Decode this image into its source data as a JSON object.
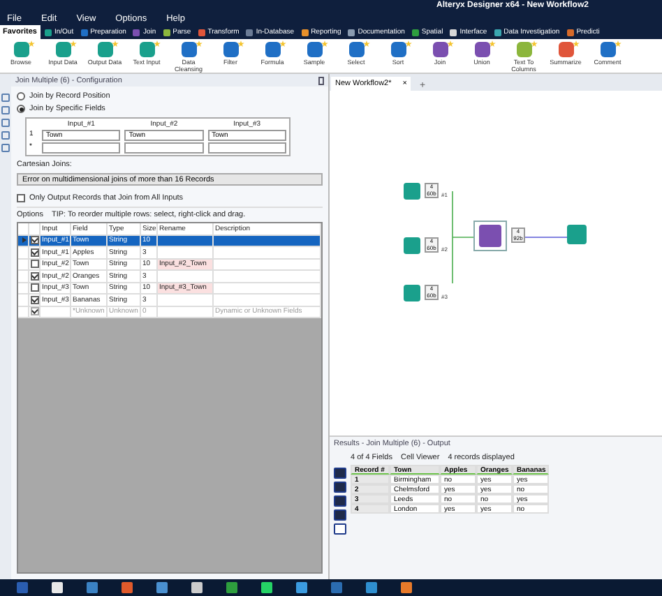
{
  "window": {
    "title": "Alteryx Designer x64 - New Workflow2"
  },
  "menu": [
    "File",
    "Edit",
    "View",
    "Options",
    "Help"
  ],
  "favorites": {
    "label": "Favorites",
    "selected": true
  },
  "categories": [
    {
      "label": "In/Out",
      "color": "#1aa08c"
    },
    {
      "label": "Preparation",
      "color": "#1f6fc5"
    },
    {
      "label": "Join",
      "color": "#7b4fb0"
    },
    {
      "label": "Parse",
      "color": "#8cb63c"
    },
    {
      "label": "Transform",
      "color": "#e0553a"
    },
    {
      "label": "In-Database",
      "color": "#6b7b95"
    },
    {
      "label": "Reporting",
      "color": "#e8902a"
    },
    {
      "label": "Documentation",
      "color": "#8a9bb0"
    },
    {
      "label": "Spatial",
      "color": "#2e9e3e"
    },
    {
      "label": "Interface",
      "color": "#d8d8d8"
    },
    {
      "label": "Data Investigation",
      "color": "#3aa6b0"
    },
    {
      "label": "Predicti",
      "color": "#d66a2a"
    }
  ],
  "tools": [
    {
      "label": "Browse",
      "color": "#1aa08c"
    },
    {
      "label": "Input Data",
      "color": "#1aa08c"
    },
    {
      "label": "Output Data",
      "color": "#1aa08c"
    },
    {
      "label": "Text Input",
      "color": "#1aa08c"
    },
    {
      "label": "Data Cleansing",
      "color": "#1f6fc5"
    },
    {
      "label": "Filter",
      "color": "#1f6fc5"
    },
    {
      "label": "Formula",
      "color": "#1f6fc5"
    },
    {
      "label": "Sample",
      "color": "#1f6fc5"
    },
    {
      "label": "Select",
      "color": "#1f6fc5"
    },
    {
      "label": "Sort",
      "color": "#1f6fc5"
    },
    {
      "label": "Join",
      "color": "#7b4fb0"
    },
    {
      "label": "Union",
      "color": "#7b4fb0"
    },
    {
      "label": "Text To Columns",
      "color": "#8cb63c"
    },
    {
      "label": "Summarize",
      "color": "#e0553a"
    },
    {
      "label": "Comment",
      "color": "#1f6fc5"
    }
  ],
  "config": {
    "title": "Join Multiple (6) - Configuration",
    "radios": [
      {
        "label": "Join by Record Position",
        "selected": false
      },
      {
        "label": "Join by Specific Fields",
        "selected": true
      }
    ],
    "join_headers": [
      "Input_#1",
      "Input_#2",
      "Input_#3"
    ],
    "join_rows": [
      {
        "index": "1",
        "values": [
          "Town",
          "Town",
          "Town"
        ]
      },
      {
        "index": "*",
        "values": []
      }
    ],
    "cartesian_label": "Cartesian Joins:",
    "cartesian_value": "Error on multidimensional joins of more than 16 Records",
    "only_output": {
      "label": "Only Output Records that Join from All Inputs",
      "checked": false
    },
    "options": "Options",
    "tip": "TIP: To reorder multiple rows: select, right-click and drag.",
    "columns": [
      "Input",
      "Field",
      "Type",
      "Size",
      "Rename",
      "Description"
    ],
    "rows": [
      {
        "selected": true,
        "checked": true,
        "disabled": false,
        "input": "Input_#1",
        "field": "Town",
        "type": "String",
        "size": "10"
      },
      {
        "selected": false,
        "checked": true,
        "disabled": false,
        "input": "Input_#1",
        "field": "Apples",
        "type": "String",
        "size": "3"
      },
      {
        "selected": false,
        "checked": false,
        "disabled": false,
        "input": "Input_#2",
        "field": "Town",
        "type": "String",
        "size": "10",
        "rename": "Input_#2_Town"
      },
      {
        "selected": false,
        "checked": true,
        "disabled": false,
        "input": "Input_#2",
        "field": "Oranges",
        "type": "String",
        "size": "3"
      },
      {
        "selected": false,
        "checked": false,
        "disabled": false,
        "input": "Input_#3",
        "field": "Town",
        "type": "String",
        "size": "10",
        "rename": "Input_#3_Town"
      },
      {
        "selected": false,
        "checked": true,
        "disabled": false,
        "input": "Input_#3",
        "field": "Bananas",
        "type": "String",
        "size": "3"
      },
      {
        "selected": false,
        "checked": true,
        "disabled": true,
        "field": "*Unknown",
        "type": "Unknown",
        "size": "0",
        "description": "Dynamic or Unknown Fields"
      }
    ]
  },
  "canvas": {
    "tab": {
      "label": "New Workflow2*",
      "close": "×"
    },
    "add_tab": "+",
    "nodes": [
      {
        "kind": "input",
        "count": "4",
        "size": "60b",
        "anchor": "#1"
      },
      {
        "kind": "input",
        "count": "4",
        "size": "60b",
        "anchor": "#2"
      },
      {
        "kind": "input",
        "count": "4",
        "size": "60b",
        "anchor": "#3"
      },
      {
        "kind": "join",
        "count": "4",
        "size": "92b"
      },
      {
        "kind": "browse"
      }
    ]
  },
  "results": {
    "title": "Results - Join Multiple (6) - Output",
    "fields": "4 of 4 Fields",
    "viewer": "Cell Viewer",
    "count": "4 records displayed",
    "columns": [
      "Record #",
      "Town",
      "Apples",
      "Oranges",
      "Bananas"
    ],
    "rows": [
      [
        "1",
        "Birmingham",
        "no",
        "yes",
        "yes"
      ],
      [
        "2",
        "Chelmsford",
        "yes",
        "yes",
        "no"
      ],
      [
        "3",
        "Leeds",
        "no",
        "no",
        "yes"
      ],
      [
        "4",
        "London",
        "yes",
        "yes",
        "no"
      ]
    ]
  }
}
